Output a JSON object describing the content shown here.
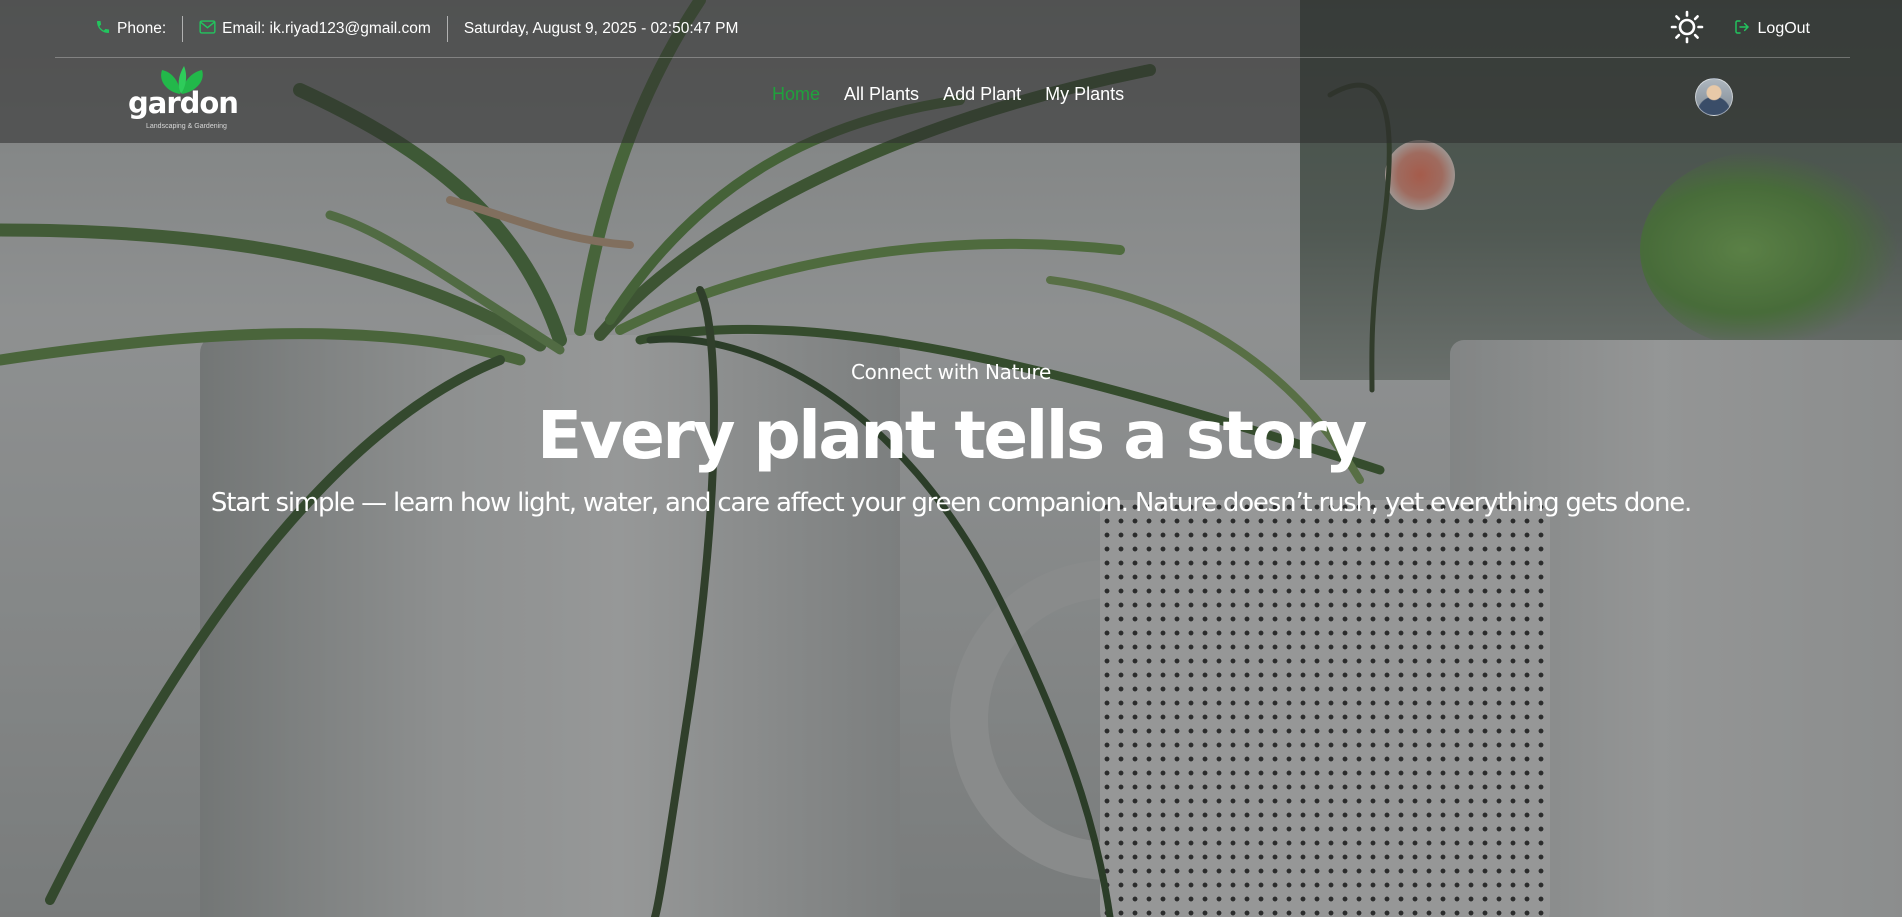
{
  "topbar": {
    "phone_label": "Phone:",
    "email_label": "Email: ik.riyad123@gmail.com",
    "datetime": "Saturday, August 9, 2025 - 02:50:47 PM",
    "logout_label": "LogOut"
  },
  "brand": {
    "name": "gardon",
    "tagline": "Landscaping & Gardening",
    "accent_color": "#1fa23c"
  },
  "nav": {
    "items": [
      {
        "label": "Home",
        "active": true
      },
      {
        "label": "All Plants",
        "active": false
      },
      {
        "label": "Add Plant",
        "active": false
      },
      {
        "label": "My Plants",
        "active": false
      }
    ]
  },
  "hero": {
    "eyebrow": "Connect with Nature",
    "title": "Every plant tells a story",
    "subtitle": "Start simple — learn how light, water, and care affect your green companion. Nature doesn’t rush, yet everything gets done."
  },
  "icons": {
    "phone": "phone-icon",
    "email": "mail-icon",
    "theme": "sun-icon",
    "logout": "logout-icon"
  }
}
